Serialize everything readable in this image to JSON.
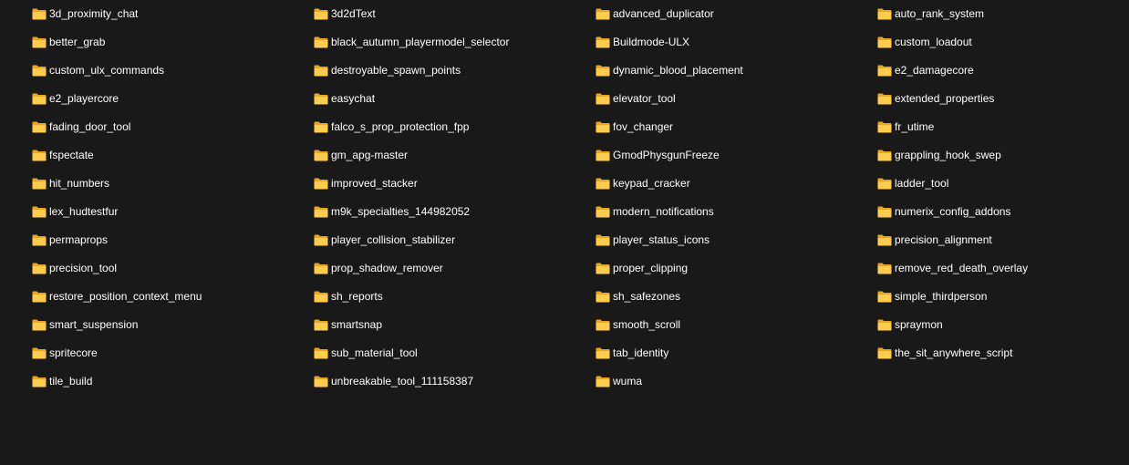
{
  "icon_name": "folder-icon",
  "colors": {
    "background": "#191919",
    "text": "#ffffff",
    "folder_back": "#e9a623",
    "folder_front": "#ffcc4d"
  },
  "folders": [
    "3d_proximity_chat",
    "3d2dText",
    "advanced_duplicator",
    "auto_rank_system",
    "better_grab",
    "black_autumn_playermodel_selector",
    "Buildmode-ULX",
    "custom_loadout",
    "custom_ulx_commands",
    "destroyable_spawn_points",
    "dynamic_blood_placement",
    "e2_damagecore",
    "e2_playercore",
    "easychat",
    "elevator_tool",
    "extended_properties",
    "fading_door_tool",
    "falco_s_prop_protection_fpp",
    "fov_changer",
    "fr_utime",
    "fspectate",
    "gm_apg-master",
    "GmodPhysgunFreeze",
    "grappling_hook_swep",
    "hit_numbers",
    "improved_stacker",
    "keypad_cracker",
    "ladder_tool",
    "lex_hudtestfur",
    "m9k_specialties_144982052",
    "modern_notifications",
    "numerix_config_addons",
    "permaprops",
    "player_collision_stabilizer",
    "player_status_icons",
    "precision_alignment",
    "precision_tool",
    "prop_shadow_remover",
    "proper_clipping",
    "remove_red_death_overlay",
    "restore_position_context_menu",
    "sh_reports",
    "sh_safezones",
    "simple_thirdperson",
    "smart_suspension",
    "smartsnap",
    "smooth_scroll",
    "spraymon",
    "spritecore",
    "sub_material_tool",
    "tab_identity",
    "the_sit_anywhere_script",
    "tile_build",
    "unbreakable_tool_111158387",
    "wuma"
  ]
}
